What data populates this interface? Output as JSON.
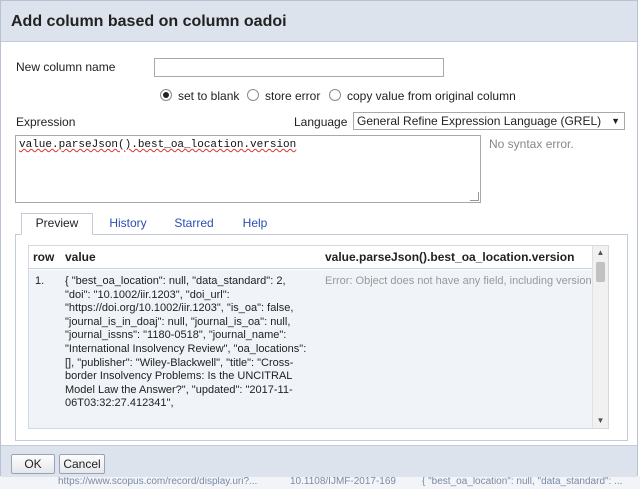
{
  "dialog": {
    "title": "Add column based on column oadoi"
  },
  "form": {
    "new_column_label": "New column name",
    "new_column_value": "",
    "on_error_options": [
      {
        "label": "set to blank",
        "checked": true
      },
      {
        "label": "store error",
        "checked": false
      },
      {
        "label": "copy value from original column",
        "checked": false
      }
    ],
    "expression_label": "Expression",
    "language_label": "Language",
    "language_selected": "General Refine Expression Language (GREL)",
    "expression_text": "value.parseJson().best_oa_location.version",
    "syntax_status": "No syntax error."
  },
  "tabs": [
    {
      "label": "Preview",
      "active": true
    },
    {
      "label": "History",
      "active": false
    },
    {
      "label": "Starred",
      "active": false
    },
    {
      "label": "Help",
      "active": false
    }
  ],
  "preview": {
    "headers": {
      "row": "row",
      "value": "value",
      "expression": "value.parseJson().best_oa_location.version"
    },
    "rows": [
      {
        "row": "1.",
        "value": "{ \"best_oa_location\": null, \"data_standard\": 2, \"doi\": \"10.1002/iir.1203\", \"doi_url\": \"https://doi.org/10.1002/iir.1203\", \"is_oa\": false, \"journal_is_in_doaj\": null, \"journal_is_oa\": null, \"journal_issns\": \"1180-0518\", \"journal_name\": \"International Insolvency Review\", \"oa_locations\": [], \"publisher\": \"Wiley-Blackwell\", \"title\": \"Cross-border Insolvency Problems: Is the UNCITRAL Model Law the Answer?\", \"updated\": \"2017-11-06T03:32:27.412341\",",
        "result": "Error: Object does not have any field, including version"
      }
    ]
  },
  "buttons": {
    "ok": "OK",
    "cancel": "Cancel"
  },
  "background_strip": {
    "left_text": "https://www.scopus.com/record/display.uri?...",
    "mid_text": "10.1108/IJMF-2017-169",
    "right_text": "{ \"best_oa_location\": null, \"data_standard\": ..."
  }
}
